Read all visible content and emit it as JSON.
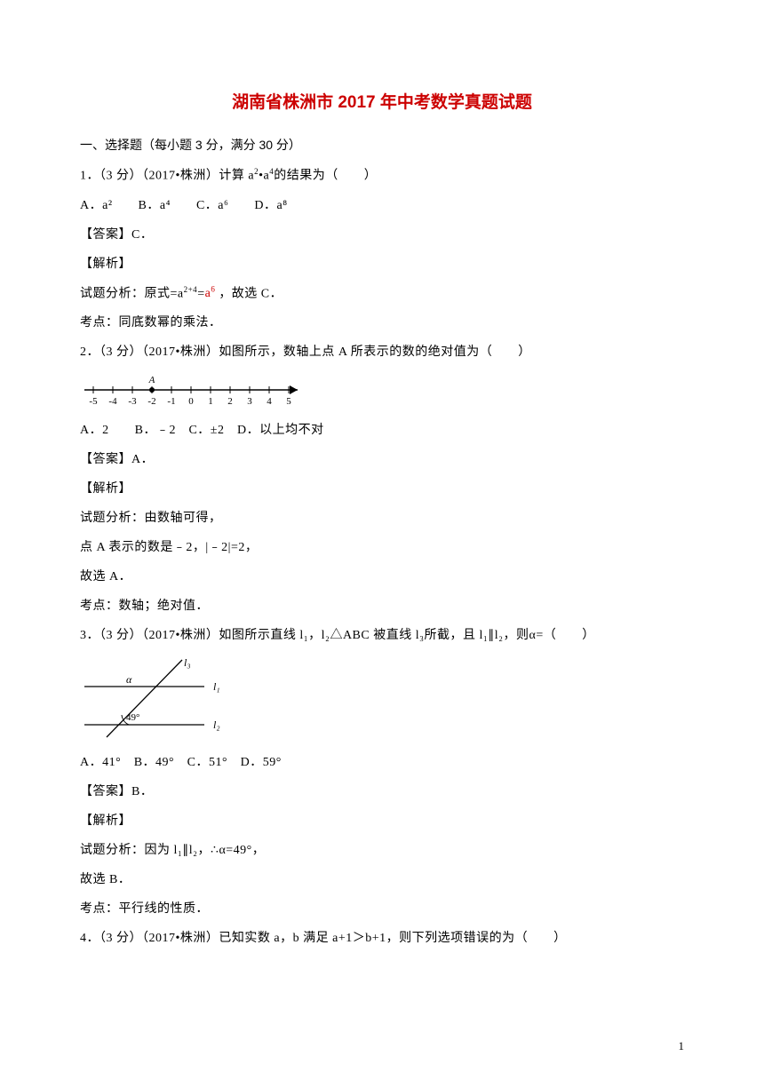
{
  "title_color": "#cc0000",
  "title": "湖南省株洲市 2017 年中考数学真题试题",
  "section_header": "一、选择题（每小题 3 分，满分 30 分）",
  "q1": {
    "stem_prefix": "1．（3 分）（2017•株洲）计算 a",
    "stem_mid": "•a",
    "stem_suffix": "的结果为（　　）",
    "opts": "A．a²　　B．a⁴　　C．a⁶　　D．a⁸",
    "ans": "【答案】C．",
    "expl_label": "【解析】",
    "analysis_prefix": "试题分析：原式=a",
    "analysis_exp": "2+4",
    "analysis_eq": "=",
    "analysis_red": "a",
    "analysis_red_sup": "6",
    "analysis_suffix": " ，故选 C．",
    "point": "考点：同底数幂的乘法．"
  },
  "q2": {
    "stem": "2．（3 分）（2017•株洲）如图所示，数轴上点 A 所表示的数的绝对值为（　　）",
    "opts": "A．2　　B．﹣2　C．±2　D．以上均不对",
    "ans": "【答案】A．",
    "expl_label": "【解析】",
    "analysis1": "试题分析：由数轴可得，",
    "analysis2": "点 A 表示的数是﹣2，|﹣2|=2，",
    "analysis3": "故选 A．",
    "point": "考点：数轴；绝对值．",
    "ticks": [
      "-5",
      "-4",
      "-3",
      "-2",
      "-1",
      "0",
      "1",
      "2",
      "3",
      "4",
      "5"
    ],
    "point_label": "A"
  },
  "q3": {
    "stem": "3．（3 分）（2017•株洲）如图所示直线 l₁，l₂△ABC 被直线 l₃所截，且 l₁∥l₂，则α=（　　）",
    "opts": "A．41°　B．49°　C．51°　D．59°",
    "ans": "【答案】B．",
    "expl_label": "【解析】",
    "analysis1": "试题分析：因为 l₁∥l₂，∴α=49°，",
    "analysis2": "故选 B．",
    "point": "考点：平行线的性质．",
    "labels": {
      "l1": "l₁",
      "l2": "l₂",
      "l3": "l₃",
      "alpha": "α",
      "angle": "49°"
    }
  },
  "q4": {
    "stem": "4．（3 分）（2017•株洲）已知实数 a，b 满足 a+1＞b+1，则下列选项错误的为（　　）"
  },
  "pagenum": "1"
}
